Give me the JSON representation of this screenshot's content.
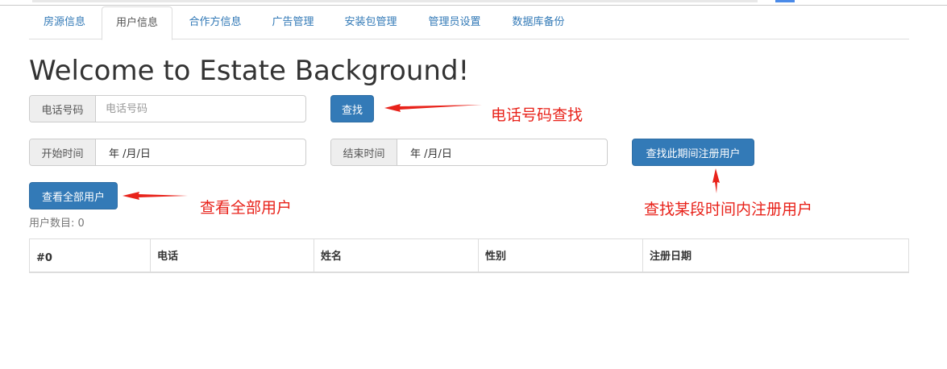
{
  "tabs": [
    {
      "label": "房源信息"
    },
    {
      "label": "用户信息",
      "active": true
    },
    {
      "label": "合作方信息"
    },
    {
      "label": "广告管理"
    },
    {
      "label": "安装包管理"
    },
    {
      "label": "管理员设置"
    },
    {
      "label": "数据库备份"
    }
  ],
  "title": "Welcome to Estate Background!",
  "phone_search": {
    "addon": "电话号码",
    "placeholder": "电话号码",
    "button": "查找"
  },
  "date_range": {
    "start_addon": "开始时间",
    "start_value": "年 /月/日",
    "end_addon": "结束时间",
    "end_value": "年 /月/日",
    "button": "查找此期间注册用户"
  },
  "view_all_button": "查看全部用户",
  "user_count": "用户数目: 0",
  "table": {
    "headers": [
      "#0",
      "电话",
      "姓名",
      "性别",
      "注册日期"
    ]
  },
  "annotations": {
    "phone": "电话号码查找",
    "view_all": "查看全部用户",
    "range": "查找某段时间内注册用户",
    "color": "#e8221a"
  },
  "colors": {
    "primary": "#337ab7",
    "link": "#337ab7"
  }
}
